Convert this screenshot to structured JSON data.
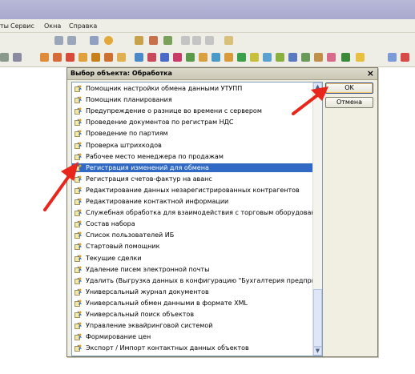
{
  "menu": {
    "items": [
      "ты",
      "Сервис",
      "Окна",
      "Справка"
    ]
  },
  "dialog": {
    "title": "Выбор объекта: Обработка",
    "ok_label": "OK",
    "cancel_label": "Отмена",
    "close_glyph": "×",
    "items": [
      "Помощник настройки обмена данными УТУПП",
      "Помощник планирования",
      "Предупреждение о разнице во времени с сервером",
      "Проведение документов по регистрам НДС",
      "Проведение по партиям",
      "Проверка штрихкодов",
      "Рабочее место менеджера по продажам",
      "Регистрация изменений для обмена",
      "Регистрация счетов-фактур на аванс",
      "Редактирование данных незарегистрированных контрагентов",
      "Редактирование контактной информации",
      "Служебная обработка для взаимодействия с торговым оборудованием",
      "Состав набора",
      "Список пользователей ИБ",
      "Стартовый помощник",
      "Текущие сделки",
      "Удаление писем электронной почты",
      "Удалить (Выгрузка данных в конфигурацию \"Бухгалтерия предприятия...",
      "Универсальный журнал документов",
      "Универсальный обмен данными в формате XML",
      "Универсальный поиск объектов",
      "Управление эквайринговой системой",
      "Формирование цен",
      "Экспорт / Импорт контактных данных объектов"
    ],
    "selected_index": 7
  },
  "colors": {
    "selection": "#316ac5",
    "arrow": "#e8261c"
  }
}
